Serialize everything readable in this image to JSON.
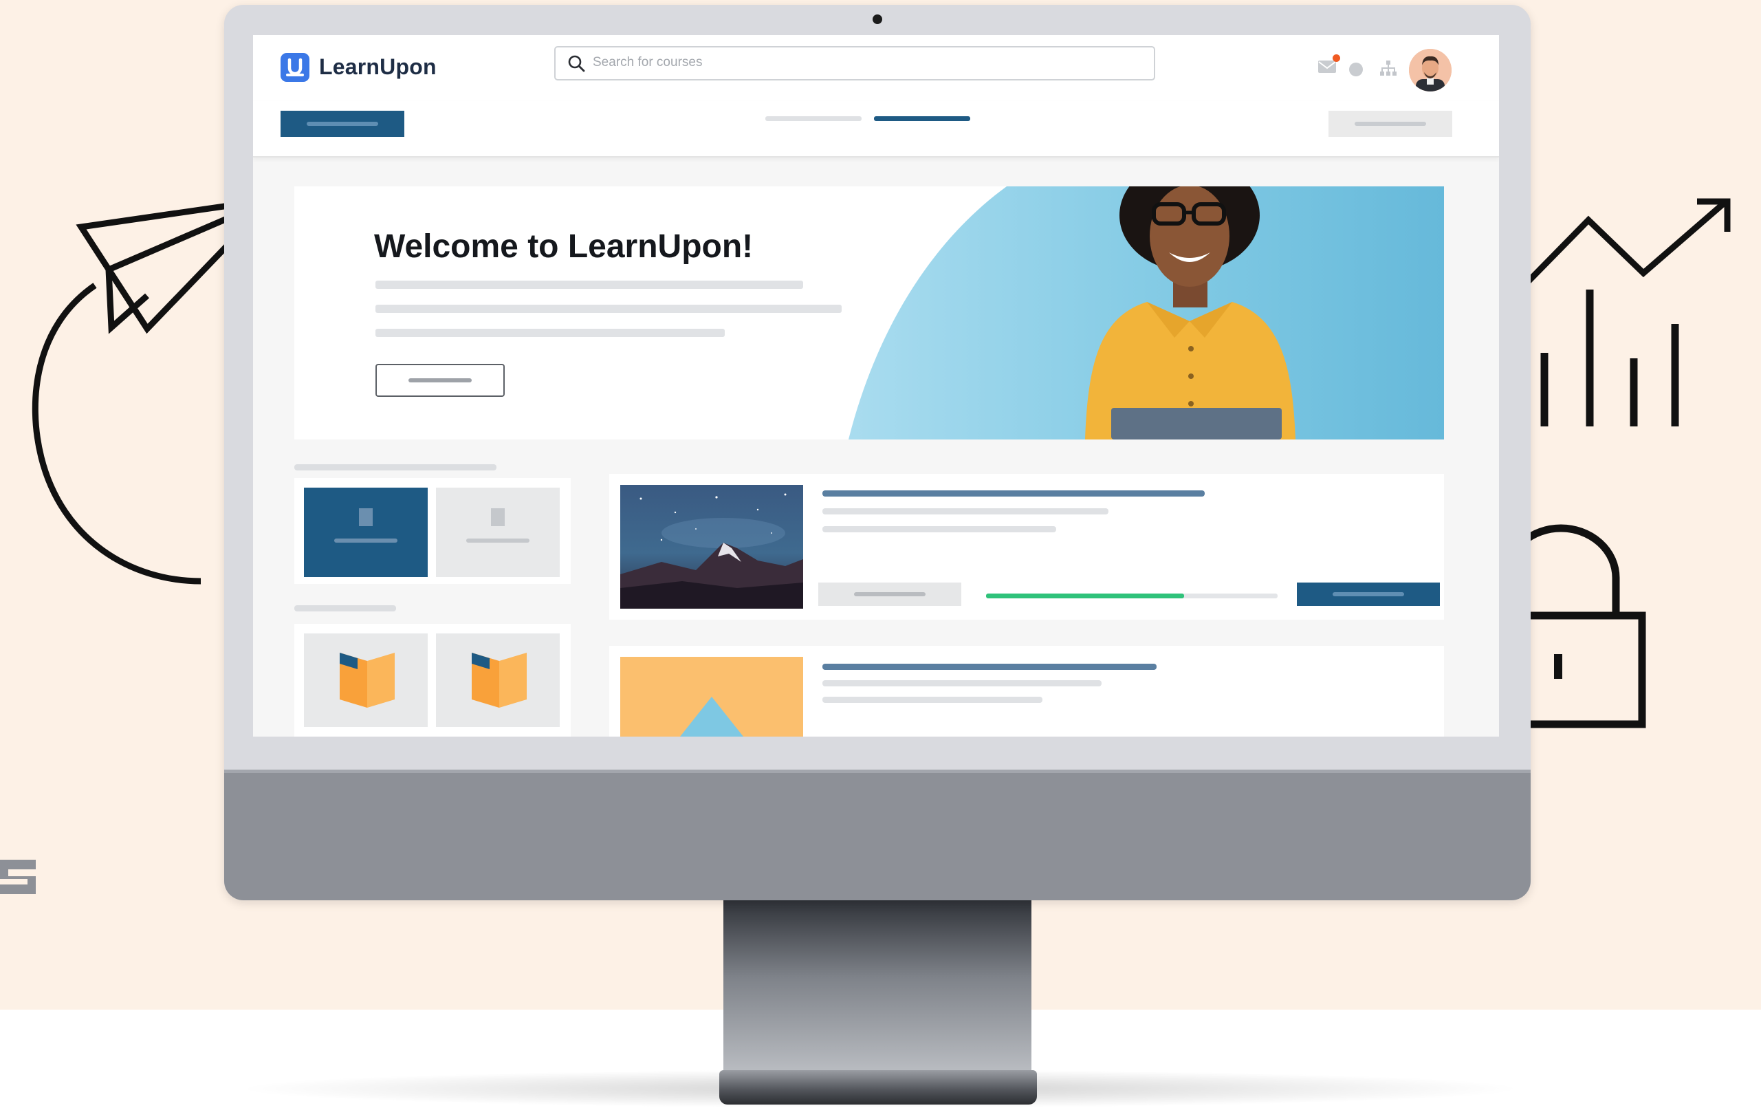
{
  "app": {
    "brand_name": "LearnUpon",
    "logo_icon": "learnupon-logo-icon"
  },
  "search": {
    "placeholder": "Search for courses",
    "value": ""
  },
  "header_icons": [
    "mail-icon",
    "status-circle-icon",
    "org-chart-icon",
    "user-avatar"
  ],
  "hero": {
    "title": "Welcome to LearnUpon!"
  },
  "courses": [
    {
      "thumbnail": "mountain-night-sky",
      "progress": 0.68
    },
    {
      "thumbnail": "orange-triangle-illustration"
    }
  ],
  "colors": {
    "brand_blue": "#1e5a84",
    "logo_blue": "#3b78e7",
    "progress_green": "#2fc27a",
    "hero_sky": "#7ec8e3",
    "background_peach": "#fdf1e6",
    "tile_orange": "#f9a13a"
  },
  "decorations": [
    "paper-plane-icon",
    "curved-arrow-icon",
    "growth-chart-icon",
    "padlock-icon"
  ]
}
